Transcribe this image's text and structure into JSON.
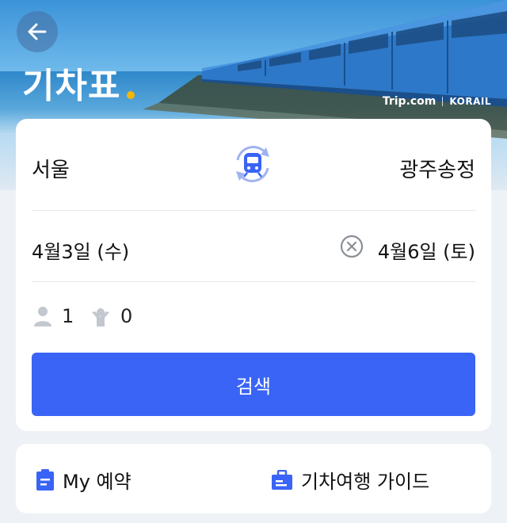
{
  "header": {
    "title": "기차표",
    "brand_tripcom": "Trip.com",
    "brand_korail": "KORAIL"
  },
  "route": {
    "from": "서울",
    "to": "광주송정"
  },
  "dates": {
    "depart": "4월3일 (수)",
    "return": "4월6일 (토)"
  },
  "passengers": {
    "adult": "1",
    "child": "0"
  },
  "search": {
    "label": "검색"
  },
  "links": {
    "my_booking": "My 예약",
    "travel_guide": "기차여행 가이드"
  },
  "colors": {
    "primary": "#3a64f5",
    "accent": "#f5b700",
    "icon_blue": "#3a64f5",
    "gray_icon": "#b8bcc4"
  },
  "icons": {
    "back": "arrow-left-icon",
    "swap": "train-swap-icon",
    "clear": "clear-circle-icon",
    "adult": "person-icon",
    "child": "child-icon",
    "my_booking": "clipboard-icon",
    "guide": "briefcase-icon"
  }
}
